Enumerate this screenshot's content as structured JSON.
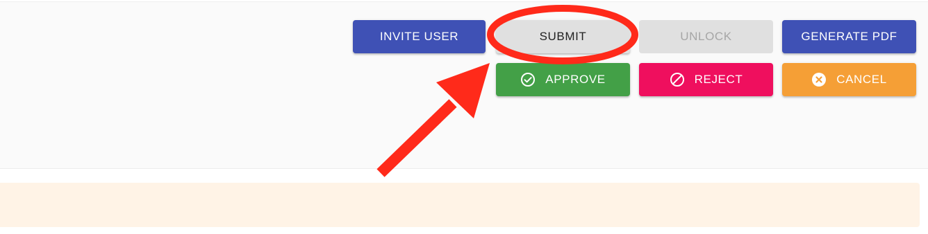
{
  "toolbar": {
    "invite_label": "INVITE USER",
    "submit_label": "SUBMIT",
    "unlock_label": "UNLOCK",
    "generate_pdf_label": "GENERATE PDF",
    "approve_label": "APPROVE",
    "reject_label": "REJECT",
    "cancel_label": "CANCEL"
  },
  "icons": {
    "approve": "check-circle-icon",
    "reject": "block-icon",
    "cancel": "close-circle-icon"
  },
  "colors": {
    "primary": "#3f51b5",
    "approve": "#43a047",
    "reject": "#ef0f5e",
    "cancel": "#f59f36",
    "disabled": "#e0e0e0",
    "annotation": "#ff2a1a",
    "notice_background": "#fff3e6"
  },
  "annotation": {
    "description_icon": "red-arrow-and-circle-highlight"
  }
}
